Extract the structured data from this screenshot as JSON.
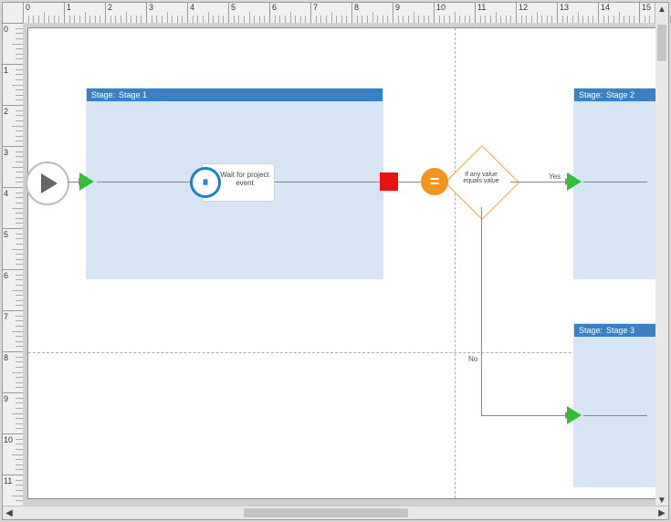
{
  "ruler": {
    "unit": "in",
    "h_start": 0,
    "h_end": 15,
    "v_start": 0,
    "v_end": 11
  },
  "page_break": {
    "vertical_at": 10.5,
    "horizontal_at": 8
  },
  "stages": {
    "stage1": {
      "label_prefix": "Stage:",
      "name": "Stage 1"
    },
    "stage2": {
      "label_prefix": "Stage:",
      "name": "Stage 2"
    },
    "stage3": {
      "label_prefix": "Stage:",
      "name": "Stage 3"
    }
  },
  "action": {
    "label": "Wait for project event",
    "icon": "pause-circle-icon"
  },
  "decision": {
    "condition": "If any value equals value",
    "operator_icon": "equals-icon",
    "yes_label": "Yes",
    "no_label": "No"
  },
  "icons": {
    "start": "play-icon",
    "stage_entry": "go-arrow-icon",
    "terminator": "stop-square-icon"
  }
}
